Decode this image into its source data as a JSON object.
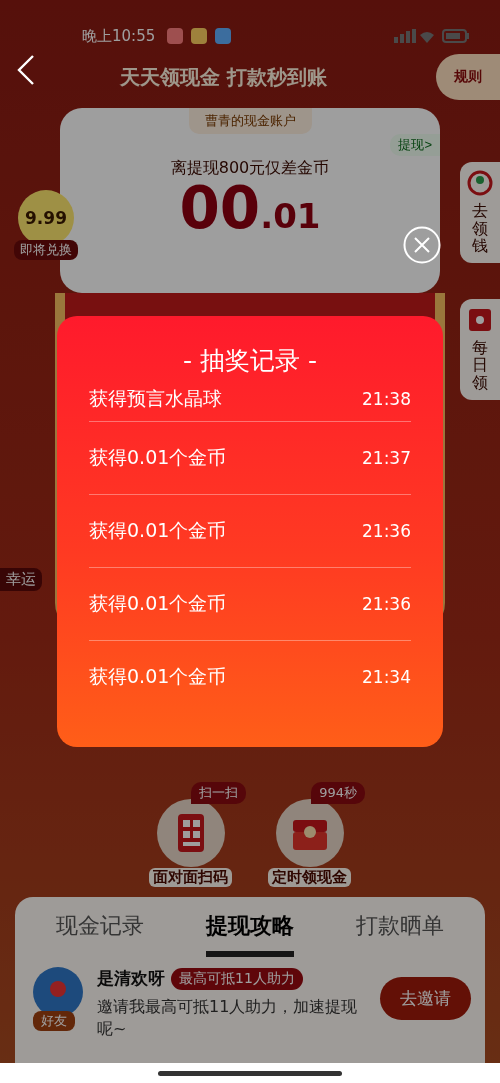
{
  "status_bar": {
    "time": "晚上10:55"
  },
  "header": {
    "title": "天天领现金 打款秒到账",
    "rule_button": "规则"
  },
  "account_card": {
    "account_label": "曹青的现金账户",
    "withdraw_link": "提现>",
    "caption": "离提现800元仅差金币",
    "amount_whole": "00",
    "amount_fraction": ".01"
  },
  "left_badge": {
    "value": "9.99",
    "label": "即将兑换"
  },
  "lucky_label": "幸运",
  "side_tabs": [
    {
      "label": "去领钱",
      "kind": "pin"
    },
    {
      "label": "每日领",
      "kind": "calendar"
    }
  ],
  "quick_actions": [
    {
      "kind": "qr",
      "badge": "扫一扫",
      "label": "面对面扫码"
    },
    {
      "kind": "chest",
      "badge": "994秒",
      "label": "定时领现金"
    }
  ],
  "tabs": [
    {
      "label": "现金记录",
      "selected": false
    },
    {
      "label": "提现攻略",
      "selected": true
    },
    {
      "label": "打款晒单",
      "selected": false
    }
  ],
  "invite": {
    "avatar_badge": "好友",
    "name": "是清欢呀",
    "tag": "最高可抵11人助力",
    "description": "邀请我最高可抵11人助力，加速提现呢~",
    "button": "去邀请"
  },
  "dialog": {
    "title": "- 抽奖记录 -",
    "records": [
      {
        "text": "获得预言水晶球",
        "time": "21:38"
      },
      {
        "text": "获得0.01个金币",
        "time": "21:37"
      },
      {
        "text": "获得0.01个金币",
        "time": "21:36"
      },
      {
        "text": "获得0.01个金币",
        "time": "21:36"
      },
      {
        "text": "获得0.01个金币",
        "time": "21:34"
      }
    ]
  }
}
